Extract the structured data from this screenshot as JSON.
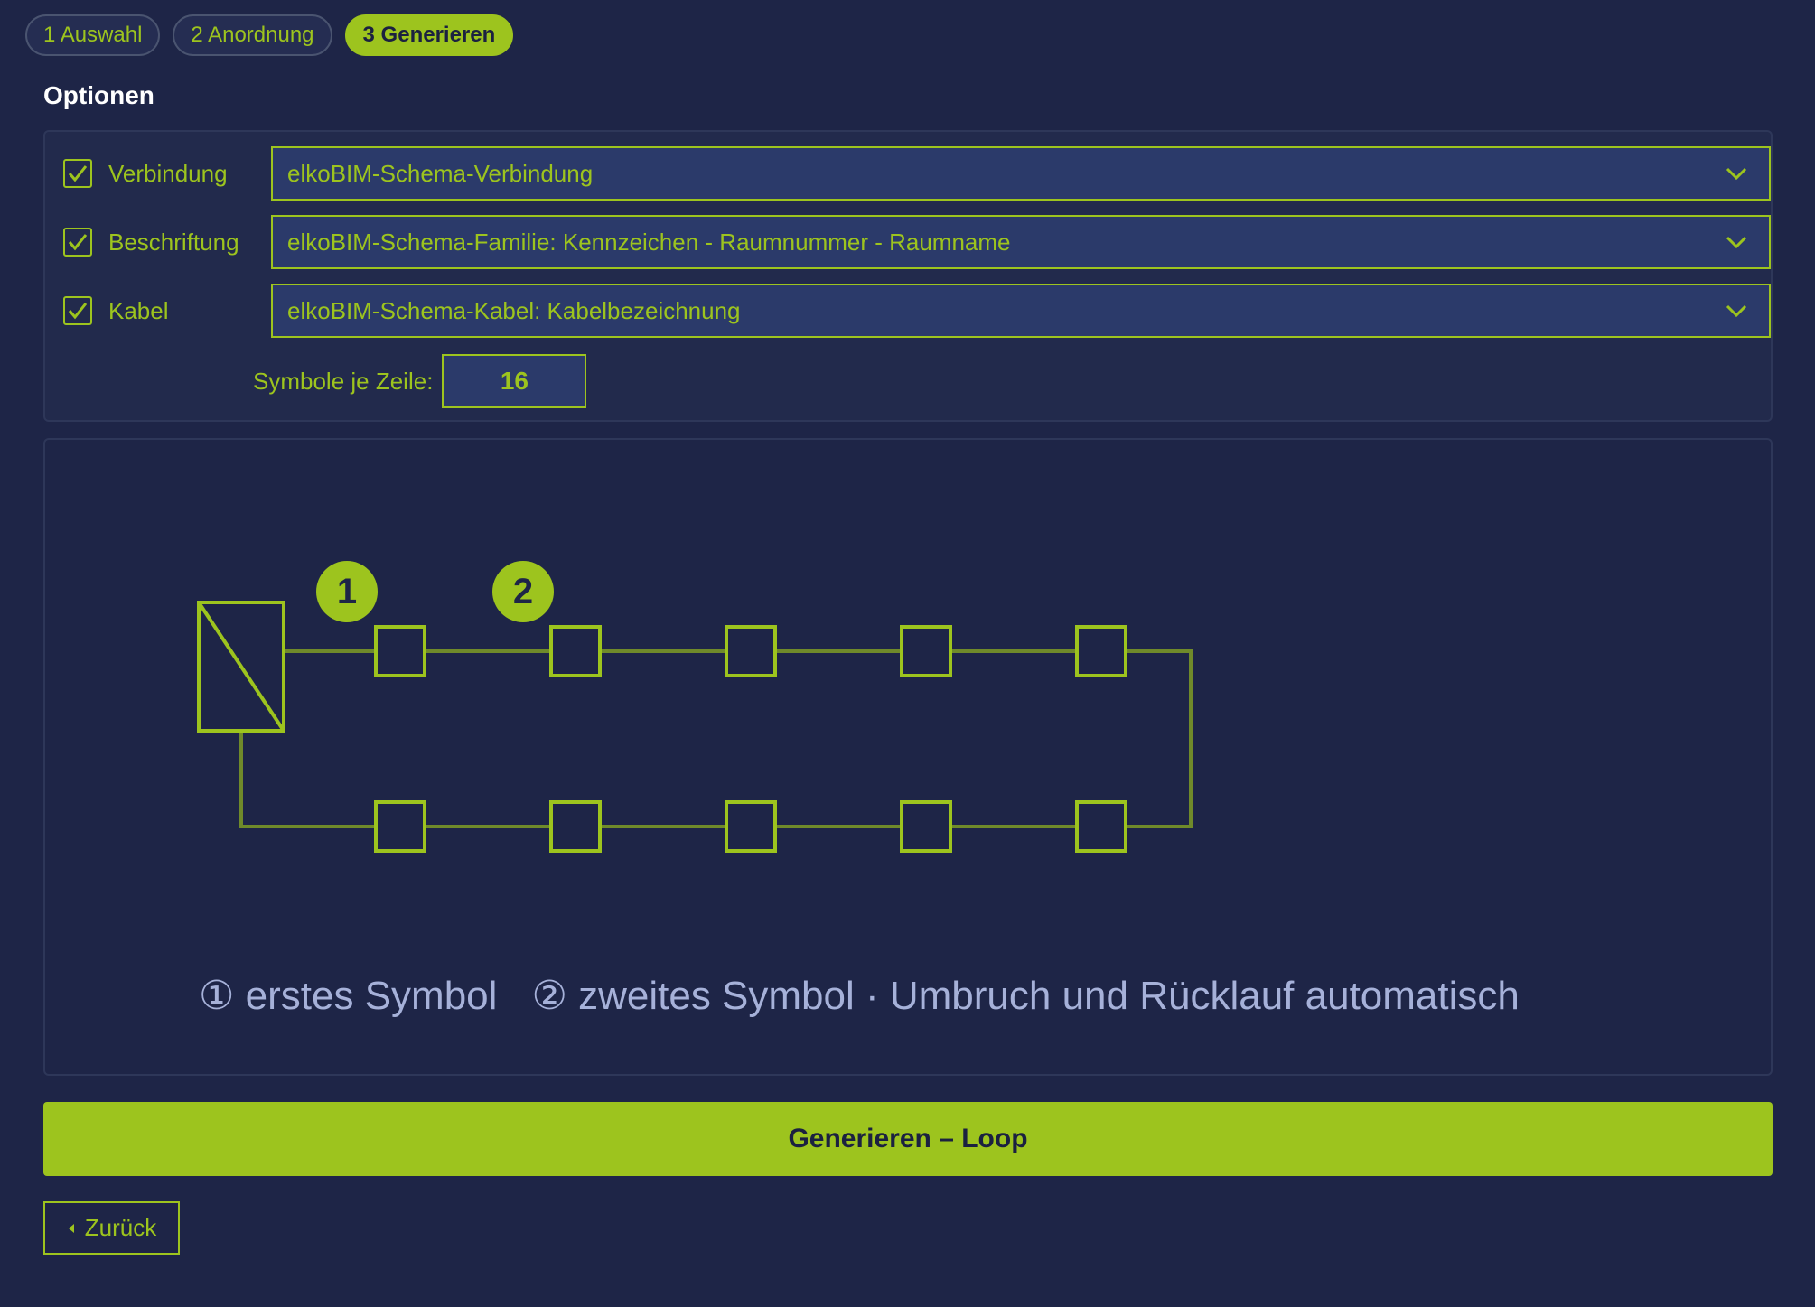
{
  "steps": [
    {
      "label": "1 Auswahl",
      "active": false
    },
    {
      "label": "2 Anordnung",
      "active": false
    },
    {
      "label": "3 Generieren",
      "active": true
    }
  ],
  "options": {
    "title": "Optionen",
    "rows": [
      {
        "label": "Verbindung",
        "checked": true,
        "value": "elkoBIM-Schema-Verbindung"
      },
      {
        "label": "Beschriftung",
        "checked": true,
        "value": "elkoBIM-Schema-Familie: Kennzeichen - Raumnummer - Raumname"
      },
      {
        "label": "Kabel",
        "checked": true,
        "value": "elkoBIM-Schema-Kabel: Kabelbezeichnung"
      }
    ],
    "symbols_per_row_label": "Symbole je Zeile:",
    "symbols_per_row_value": "16"
  },
  "diagram": {
    "markers": [
      "1",
      "2"
    ],
    "symbols_top_row": 5,
    "symbols_bottom_row": 5,
    "legend": {
      "first": "① erstes Symbol",
      "second": "② zweites Symbol · Umbruch und Rücklauf automatisch"
    }
  },
  "generate_label": "Generieren – Loop",
  "back_label": "Zurück",
  "colors": {
    "background": "#1e2547",
    "accent": "#9dc41e",
    "line": "#6f8a2a",
    "legend_text": "#a6b1d9"
  }
}
